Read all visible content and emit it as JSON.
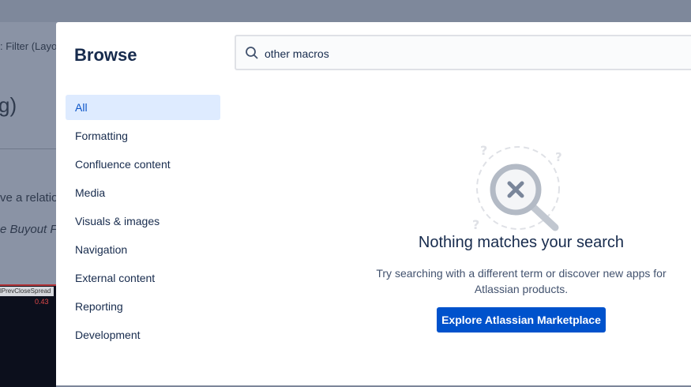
{
  "background": {
    "filter_text": ": Filter (Layo",
    "paren_text": "g)",
    "line1": "ve a relatio",
    "line2": "e Buyout Fi",
    "spread_label": "lPrevCloseSpread",
    "spread_value": "0.43"
  },
  "modal": {
    "title": "Browse",
    "search": {
      "value": "other macros",
      "icon": "search-icon"
    },
    "nav": {
      "items": [
        {
          "label": "All",
          "active": true
        },
        {
          "label": "Formatting"
        },
        {
          "label": "Confluence content"
        },
        {
          "label": "Media"
        },
        {
          "label": "Visuals & images"
        },
        {
          "label": "Navigation"
        },
        {
          "label": "External content"
        },
        {
          "label": "Reporting"
        },
        {
          "label": "Development"
        }
      ]
    },
    "empty_state": {
      "title": "Nothing matches your search",
      "description_line1": "Try searching with a different term or discover new apps for",
      "description_line2": "Atlassian products.",
      "button_label": "Explore Atlassian Marketplace",
      "illustration": "magnifier-x-icon"
    }
  },
  "colors": {
    "accent": "#0052cc",
    "nav_active_bg": "#deebff",
    "text_primary": "#172b4d",
    "text_secondary": "#42526e"
  }
}
